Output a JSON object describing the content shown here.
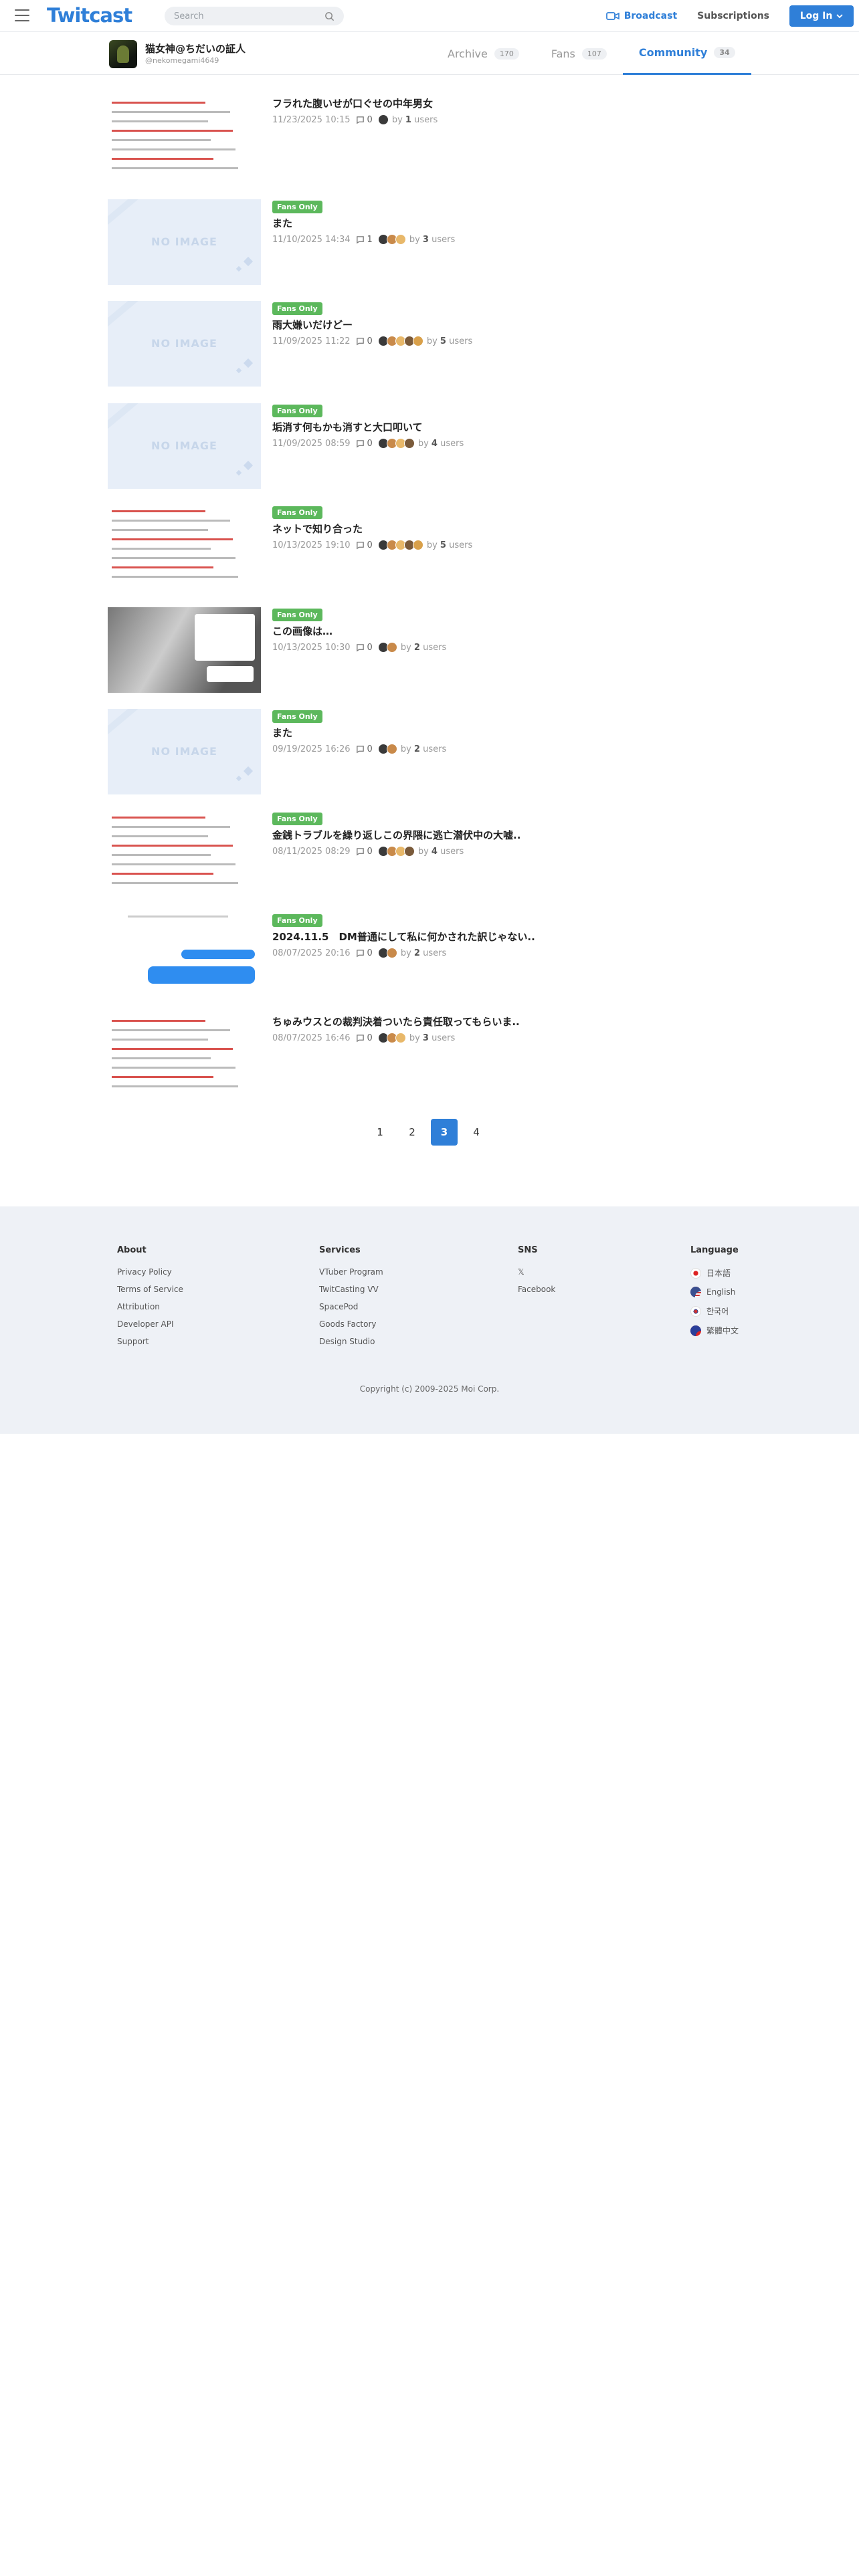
{
  "header": {
    "logo": "Twitcast",
    "search_placeholder": "Search",
    "broadcast_label": "Broadcast",
    "subscriptions_label": "Subscriptions",
    "login_label": "Log In",
    "accent": "#2f7fd8"
  },
  "profile": {
    "name": "猫女神@ちだいの証人",
    "id": "@nekomegami4649",
    "tabs": [
      {
        "label": "Archive",
        "count": "170"
      },
      {
        "label": "Fans",
        "count": "107"
      },
      {
        "label": "Community",
        "count": "34"
      }
    ],
    "active_tab": "Community"
  },
  "posts": [
    {
      "fans_only": false,
      "title": "フラれた腹いせが口ぐせの中年男女",
      "date": "11/23/2025 10:15",
      "comments": "0",
      "by": "by",
      "users": "1",
      "users_suffix": "users",
      "thumb": "screenshot"
    },
    {
      "fans_only": true,
      "badge": "Fans Only",
      "title": "また",
      "date": "11/10/2025 14:34",
      "comments": "1",
      "by": "by",
      "users": "3",
      "users_suffix": "users",
      "thumb": "NO IMAGE"
    },
    {
      "fans_only": true,
      "badge": "Fans Only",
      "title": "雨大嫌いだけどー",
      "date": "11/09/2025 11:22",
      "comments": "0",
      "by": "by",
      "users": "5",
      "users_suffix": "users",
      "thumb": "NO IMAGE"
    },
    {
      "fans_only": true,
      "badge": "Fans Only",
      "title": "垢消す何もかも消すと大口叩いて",
      "date": "11/09/2025 08:59",
      "comments": "0",
      "by": "by",
      "users": "4",
      "users_suffix": "users",
      "thumb": "NO IMAGE"
    },
    {
      "fans_only": true,
      "badge": "Fans Only",
      "title": "ネットで知り合った",
      "date": "10/13/2025 19:10",
      "comments": "0",
      "by": "by",
      "users": "5",
      "users_suffix": "users",
      "thumb": "screenshot"
    },
    {
      "fans_only": true,
      "badge": "Fans Only",
      "title": "この画像は…",
      "date": "10/13/2025 10:30",
      "comments": "0",
      "by": "by",
      "users": "2",
      "users_suffix": "users",
      "thumb": "photo"
    },
    {
      "fans_only": true,
      "badge": "Fans Only",
      "title": "また",
      "date": "09/19/2025 16:26",
      "comments": "0",
      "by": "by",
      "users": "2",
      "users_suffix": "users",
      "thumb": "NO IMAGE"
    },
    {
      "fans_only": true,
      "badge": "Fans Only",
      "title": "金銭トラブルを繰り返しこの界隈に逃亡潜伏中の大嘘..",
      "date": "08/11/2025 08:29",
      "comments": "0",
      "by": "by",
      "users": "4",
      "users_suffix": "users",
      "thumb": "screenshot"
    },
    {
      "fans_only": true,
      "badge": "Fans Only",
      "title": "2024.11.5　DM普通にして私に何かされた訳じゃない..",
      "date": "08/07/2025 20:16",
      "comments": "0",
      "by": "by",
      "users": "2",
      "users_suffix": "users",
      "thumb": "chat"
    },
    {
      "fans_only": false,
      "title": "ちゅみウスとの裁判決着ついたら責任取ってもらいま..",
      "date": "08/07/2025 16:46",
      "comments": "0",
      "by": "by",
      "users": "3",
      "users_suffix": "users",
      "thumb": "screenshot"
    }
  ],
  "pagination": {
    "pages": [
      "1",
      "2",
      "3",
      "4"
    ],
    "current": "3"
  },
  "footer": {
    "about": {
      "heading": "About",
      "links": [
        "Privacy Policy",
        "Terms of Service",
        "Attribution",
        "Developer API",
        "Support"
      ]
    },
    "services": {
      "heading": "Services",
      "links": [
        "VTuber Program",
        "TwitCasting VV",
        "SpacePod",
        "Goods Factory",
        "Design Studio"
      ]
    },
    "sns": {
      "heading": "SNS",
      "links": [
        "𝕏",
        "Facebook"
      ]
    },
    "language": {
      "heading": "Language",
      "links": [
        "日本語",
        "English",
        "한국어",
        "繁體中文"
      ]
    },
    "copyright": "Copyright (c) 2009-2025 Moi Corp."
  },
  "colors": {
    "fans_only_badge": "#5cb85c",
    "footer_bg": "#eef1f6"
  }
}
